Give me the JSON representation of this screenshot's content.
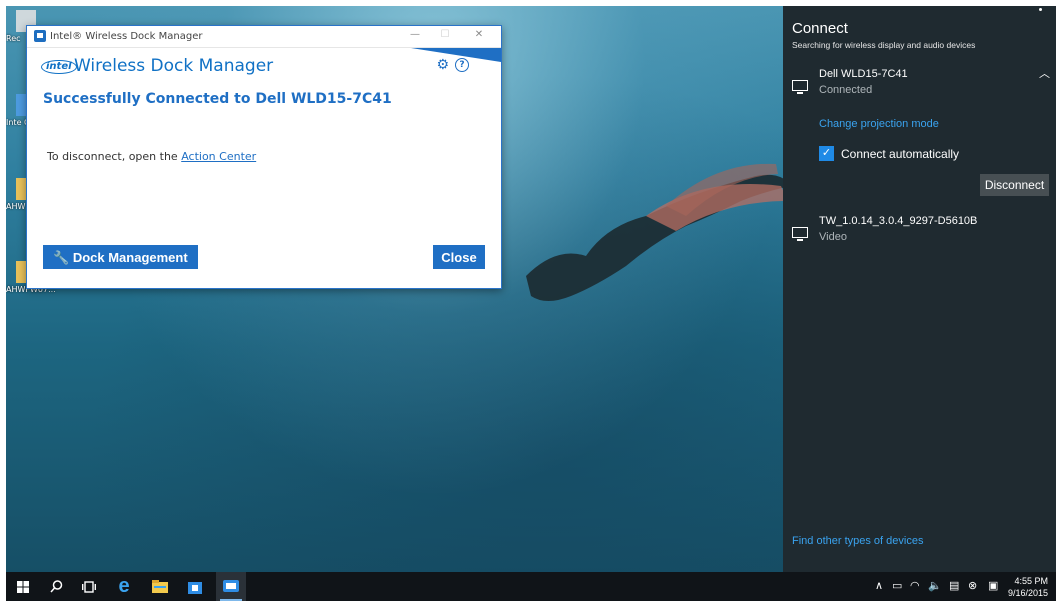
{
  "desktop": {
    "icons": [
      {
        "label": "Rec",
        "icon": "recycle-bin-icon"
      },
      {
        "label": "Inte Gra",
        "icon": "intel-graphics-icon"
      },
      {
        "label": "AHW",
        "icon": "folder-icon"
      },
      {
        "label": "AHWFW07...",
        "icon": "folder-icon"
      }
    ]
  },
  "dock_window": {
    "titlebar_title": "Intel® Wireless Dock Manager",
    "logo_text": "intel",
    "app_name": "Wireless Dock Manager",
    "success_message": "Successfully Connected to Dell WLD15-7C41",
    "instruction_prefix": "To disconnect, open the",
    "action_center_link": "Action Center",
    "dock_management_label": "Dock Management",
    "close_label": "Close",
    "minimize_glyph": "—",
    "maximize_glyph": "☐",
    "close_glyph": "✕",
    "accent_color": "#1f6fc4"
  },
  "connect_panel": {
    "title": "Connect",
    "subtitle": "Searching for wireless display and audio devices",
    "devices": [
      {
        "name": "Dell WLD15-7C41",
        "status": "Connected",
        "icon": "monitor-icon"
      },
      {
        "name": "TW_1.0.14_3.0.4_9297-D5610B",
        "status": "Video",
        "icon": "monitor-icon"
      }
    ],
    "change_projection_label": "Change projection mode",
    "connect_auto_label": "Connect automatically",
    "connect_auto_checked": true,
    "disconnect_label": "Disconnect",
    "find_other_label": "Find other types of devices",
    "link_color": "#3aa3ef"
  },
  "taskbar": {
    "items": [
      "start-icon",
      "search-icon",
      "task-view-icon",
      "edge-icon",
      "file-explorer-icon",
      "store-icon",
      "wireless-dock-app-icon"
    ],
    "tray_icons": [
      "chevron-up-icon",
      "network-icon",
      "wifi-icon",
      "volume-icon",
      "action-center-icon",
      "close-icon",
      "tray-app-icon"
    ],
    "time": "4:55 PM",
    "date": "9/16/2015"
  }
}
